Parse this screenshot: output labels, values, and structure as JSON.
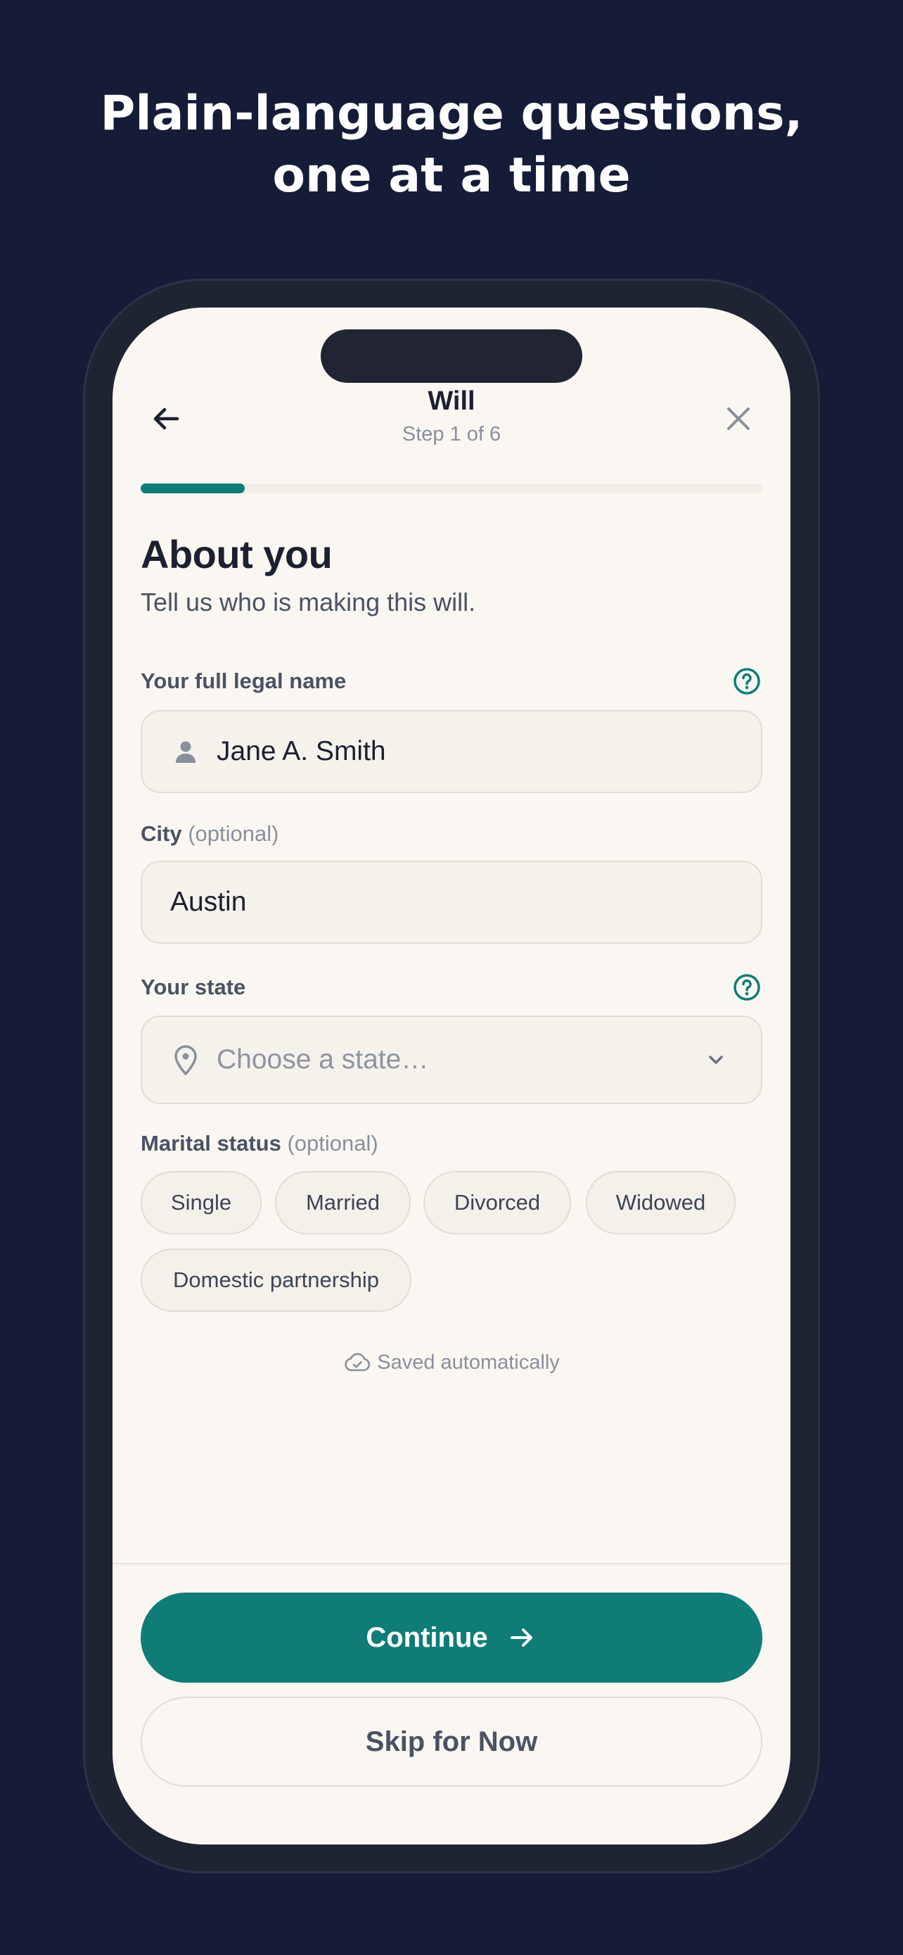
{
  "headline": "Plain-language questions, one at a time",
  "colors": {
    "background": "#141c38",
    "accent": "#0f7c78",
    "screen": "#faf7f2"
  },
  "nav": {
    "title": "Will",
    "step": "Step 1 of 6",
    "back_icon": "arrow-left-icon",
    "close_icon": "close-icon",
    "progress": 0.167
  },
  "page": {
    "title": "About you",
    "subtitle": "Tell us who is making this will."
  },
  "fields": {
    "name": {
      "label": "Your full legal name",
      "value": "Jane A. Smith",
      "icon": "person-icon",
      "help_icon": "help-circle-icon"
    },
    "city": {
      "label": "City",
      "optional": "(optional)",
      "value": "Austin"
    },
    "state": {
      "label": "Your state",
      "placeholder": "Choose a state…",
      "icon": "map-pin-icon",
      "dropdown_icon": "chevron-down-icon",
      "help_icon": "help-circle-icon"
    },
    "marital": {
      "label": "Marital status",
      "optional": "(optional)",
      "options": [
        "Single",
        "Married",
        "Divorced",
        "Widowed",
        "Domestic partnership"
      ]
    }
  },
  "saved_status": "Saved automatically",
  "actions": {
    "continue": "Continue",
    "skip": "Skip for Now"
  }
}
